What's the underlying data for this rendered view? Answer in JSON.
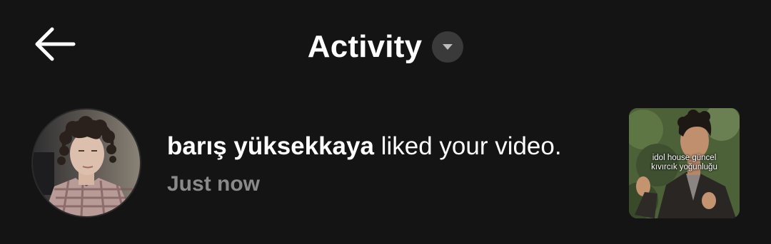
{
  "header": {
    "title": "Activity",
    "back_icon": "arrow-left-icon",
    "dropdown_icon": "caret-down-icon"
  },
  "notification": {
    "username": "barış yüksekkaya",
    "action": " liked your video.",
    "timestamp": "Just now",
    "thumbnail_caption_line1": "idol house güncel",
    "thumbnail_caption_line2": "kıvırcık yoğunluğu"
  },
  "colors": {
    "background": "#141414",
    "text_primary": "#ffffff",
    "text_secondary": "#8a8a8a",
    "dropdown_bg": "#3a3a3a"
  }
}
